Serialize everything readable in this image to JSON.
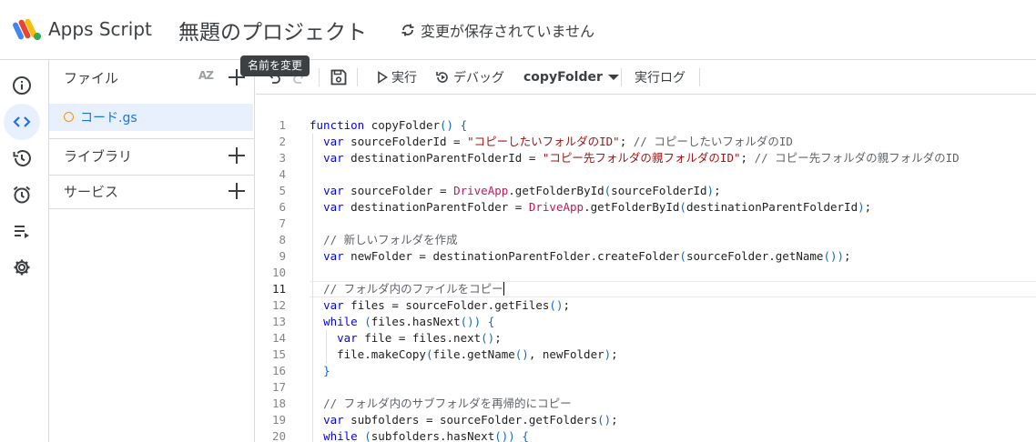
{
  "header": {
    "app_name": "Apps Script",
    "project_title": "無題のプロジェクト",
    "save_status": "変更が保存されていません"
  },
  "rail": {
    "items": [
      {
        "icon": "info-icon"
      },
      {
        "icon": "code-icon",
        "active": true
      },
      {
        "icon": "history-icon"
      },
      {
        "icon": "alarm-icon"
      },
      {
        "icon": "executions-icon"
      },
      {
        "icon": "gear-icon"
      }
    ]
  },
  "panel": {
    "files_label": "ファイル",
    "sort_label": "AZ",
    "file_name": "コード.gs",
    "libraries_label": "ライブラリ",
    "services_label": "サービス"
  },
  "tooltip": "名前を変更",
  "toolbar": {
    "run_label": "実行",
    "debug_label": "デバッグ",
    "function_select": "copyFolder",
    "log_label": "実行ログ"
  },
  "editor": {
    "current_line": 11,
    "lines": [
      {
        "n": "1",
        "html": "<span class=\"k\">function</span> copyFolder<span class=\"p\">()</span> <span class=\"p\">{</span>"
      },
      {
        "n": "2",
        "html": "  <span class=\"k\">var</span> sourceFolderId = <span class=\"s\">\"コピーしたいフォルダのID\"</span>; <span class=\"c\">// コピーしたいフォルダのID</span>"
      },
      {
        "n": "3",
        "html": "  <span class=\"k\">var</span> destinationParentFolderId = <span class=\"s\">\"コピー先フォルダの親フォルダのID\"</span>; <span class=\"c\">// コピー先フォルダの親フォルダのID</span>"
      },
      {
        "n": "4",
        "html": ""
      },
      {
        "n": "5",
        "html": "  <span class=\"k\">var</span> sourceFolder = <span class=\"cls\">DriveApp</span>.getFolderById<span class=\"p\">(</span>sourceFolderId<span class=\"p\">)</span>;"
      },
      {
        "n": "6",
        "html": "  <span class=\"k\">var</span> destinationParentFolder = <span class=\"cls\">DriveApp</span>.getFolderById<span class=\"p\">(</span>destinationParentFolderId<span class=\"p\">)</span>;"
      },
      {
        "n": "7",
        "html": ""
      },
      {
        "n": "8",
        "html": "  <span class=\"c\">// 新しいフォルダを作成</span>"
      },
      {
        "n": "9",
        "html": "  <span class=\"k\">var</span> newFolder = destinationParentFolder.createFolder<span class=\"p\">(</span>sourceFolder.getName<span class=\"p\">())</span>;"
      },
      {
        "n": "10",
        "html": ""
      },
      {
        "n": "11",
        "html": "  <span class=\"c\">// フォルダ内のファイルをコピー</span><span class=\"cursor\"></span>"
      },
      {
        "n": "12",
        "html": "  <span class=\"k\">var</span> files = sourceFolder.getFiles<span class=\"p\">()</span>;"
      },
      {
        "n": "13",
        "html": "  <span class=\"k\">while</span> <span class=\"p\">(</span>files.hasNext<span class=\"p\">())</span> <span class=\"p\">{</span>"
      },
      {
        "n": "14",
        "html": "    <span class=\"k\">var</span> file = files.next<span class=\"p\">()</span>;"
      },
      {
        "n": "15",
        "html": "    file.makeCopy<span class=\"p\">(</span>file.getName<span class=\"p\">()</span>, newFolder<span class=\"p\">)</span>;"
      },
      {
        "n": "16",
        "html": "  <span class=\"p\">}</span>"
      },
      {
        "n": "17",
        "html": ""
      },
      {
        "n": "18",
        "html": "  <span class=\"c\">// フォルダ内のサブフォルダを再帰的にコピー</span>"
      },
      {
        "n": "19",
        "html": "  <span class=\"k\">var</span> subfolders = sourceFolder.getFolders<span class=\"p\">()</span>;"
      },
      {
        "n": "20",
        "html": "  <span class=\"k\">while</span> <span class=\"p\">(</span>subfolders.hasNext<span class=\"p\">())</span> <span class=\"p\">{</span>"
      }
    ]
  }
}
